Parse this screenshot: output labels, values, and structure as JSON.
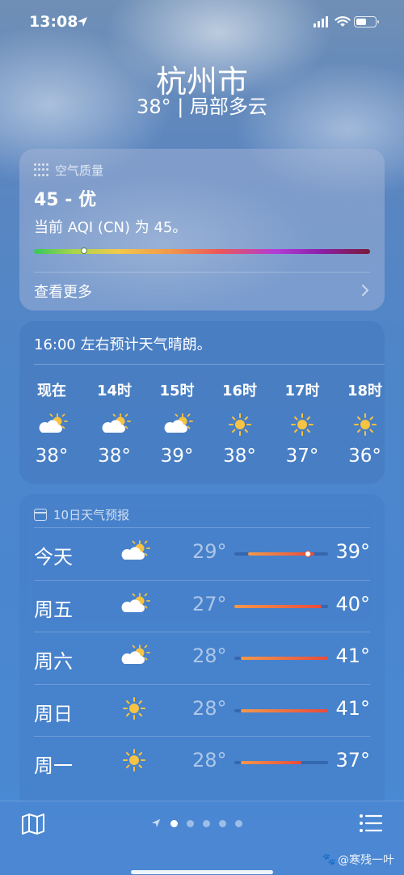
{
  "status_bar": {
    "time": "13:08"
  },
  "header": {
    "city": "杭州市",
    "subtitle": "38° | 局部多云"
  },
  "air_quality": {
    "title": "空气质量",
    "value": "45 - 优",
    "description": "当前 AQI (CN) 为 45。",
    "aqi": 45,
    "more_label": "查看更多"
  },
  "hourly": {
    "summary": "16:00 左右预计天气晴朗。",
    "items": [
      {
        "label": "现在",
        "icon": "partly-cloudy-icon",
        "temp": "38°"
      },
      {
        "label": "14时",
        "icon": "partly-cloudy-icon",
        "temp": "38°"
      },
      {
        "label": "15时",
        "icon": "partly-cloudy-icon",
        "temp": "39°"
      },
      {
        "label": "16时",
        "icon": "sun-icon",
        "temp": "38°"
      },
      {
        "label": "17时",
        "icon": "sun-icon",
        "temp": "37°"
      },
      {
        "label": "18时",
        "icon": "sun-icon",
        "temp": "36°"
      }
    ]
  },
  "daily": {
    "title": "10日天气预报",
    "range_min": 27,
    "range_max": 41,
    "days": [
      {
        "name": "今天",
        "icon": "partly-cloudy-icon",
        "low": "29°",
        "high": "39°",
        "low_val": 29,
        "high_val": 39,
        "current": 38
      },
      {
        "name": "周五",
        "icon": "partly-cloudy-icon",
        "low": "27°",
        "high": "40°",
        "low_val": 27,
        "high_val": 40
      },
      {
        "name": "周六",
        "icon": "partly-cloudy-icon",
        "low": "28°",
        "high": "41°",
        "low_val": 28,
        "high_val": 41
      },
      {
        "name": "周日",
        "icon": "sun-icon",
        "low": "28°",
        "high": "41°",
        "low_val": 28,
        "high_val": 41
      },
      {
        "name": "周一",
        "icon": "sun-icon",
        "low": "28°",
        "high": "37°",
        "low_val": 28,
        "high_val": 37
      }
    ]
  },
  "bottom_bar": {
    "pages": 5,
    "active_page": 0
  },
  "watermark": "@寒残一叶"
}
